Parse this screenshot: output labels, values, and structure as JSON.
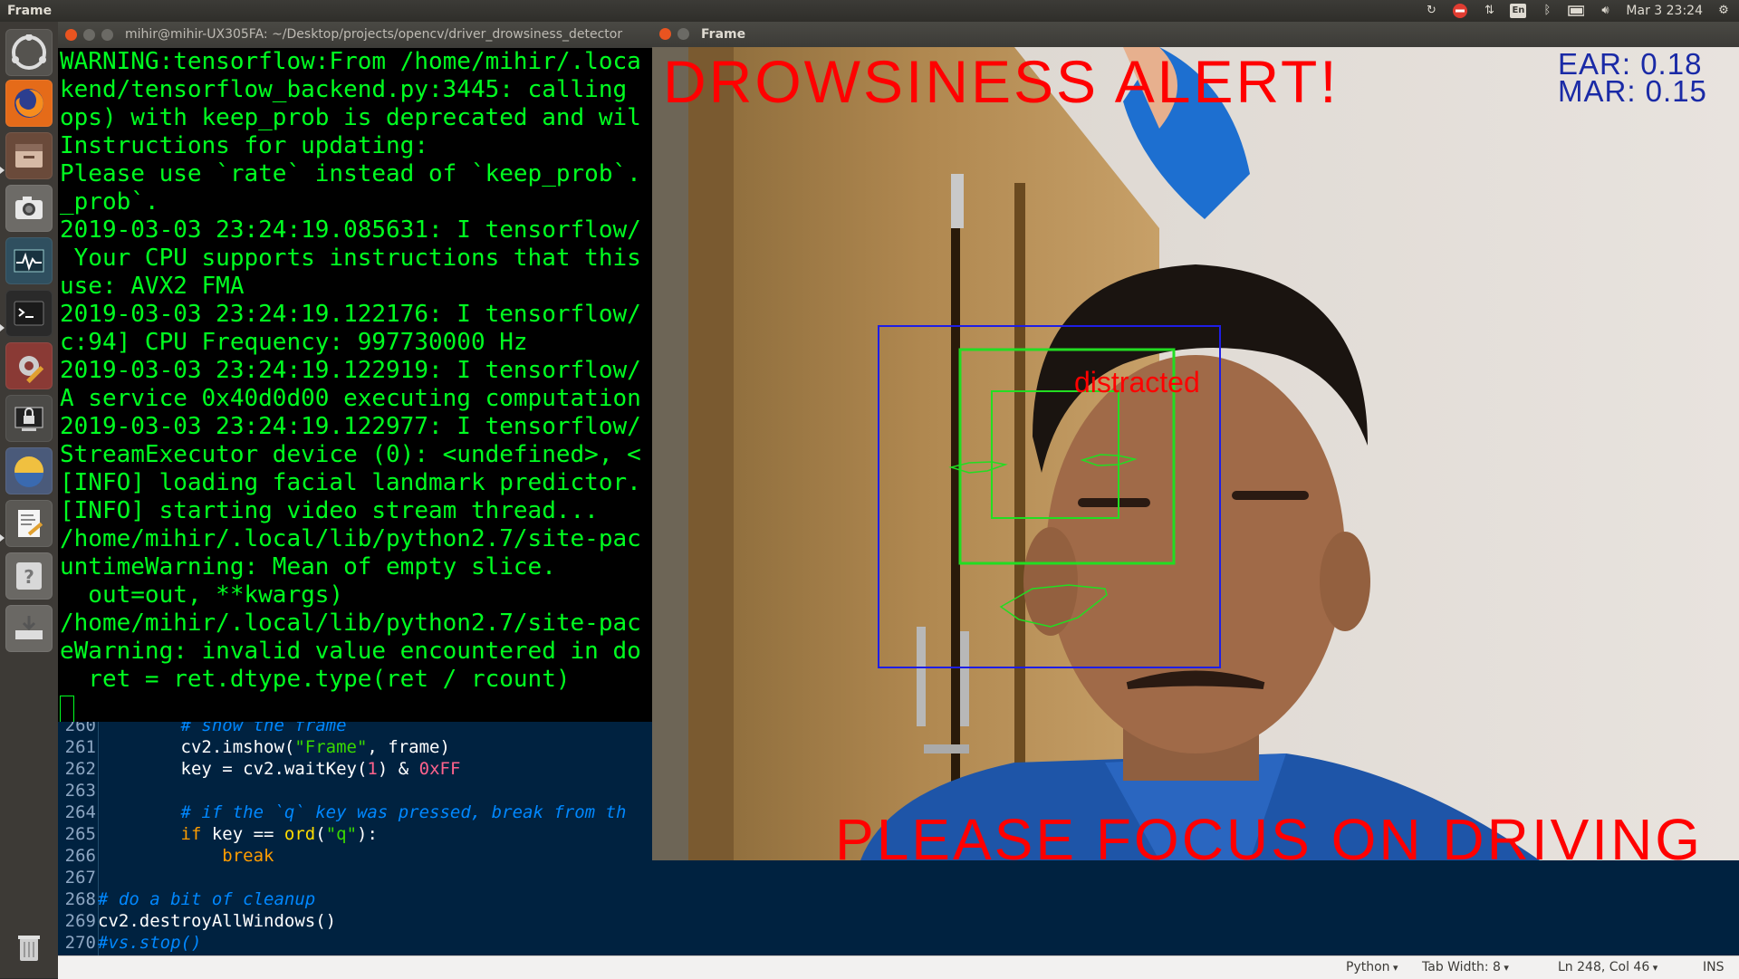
{
  "top_panel": {
    "app_name": "Frame",
    "keyboard_layout": "En",
    "clock": "Mar 3 23:24"
  },
  "launcher": {
    "items": [
      "ubuntu-logo-icon",
      "firefox-icon",
      "files-icon",
      "screenshot-camera-icon",
      "system-monitor-icon",
      "terminal-icon",
      "settings-icon",
      "lock-screen-icon",
      "image-viewer-icon",
      "text-editor-icon",
      "help-icon",
      "disk-install-icon",
      "trash-icon"
    ]
  },
  "terminal_window": {
    "title": "mihir@mihir-UX305FA: ~/Desktop/projects/opencv/driver_drowsiness_detector",
    "lines": [
      "WARNING:tensorflow:From /home/mihir/.loca",
      "kend/tensorflow_backend.py:3445: calling ",
      "ops) with keep_prob is deprecated and wil",
      "Instructions for updating:",
      "Please use `rate` instead of `keep_prob`.",
      "_prob`.",
      "2019-03-03 23:24:19.085631: I tensorflow/",
      " Your CPU supports instructions that this",
      "use: AVX2 FMA",
      "2019-03-03 23:24:19.122176: I tensorflow/",
      "c:94] CPU Frequency: 997730000 Hz",
      "2019-03-03 23:24:19.122919: I tensorflow/",
      "A service 0x40d0d00 executing computation",
      "2019-03-03 23:24:19.122977: I tensorflow/",
      "StreamExecutor device (0): <undefined>, <",
      "[INFO] loading facial landmark predictor.",
      "[INFO] starting video stream thread...",
      "/home/mihir/.local/lib/python2.7/site-pac",
      "untimeWarning: Mean of empty slice.",
      "  out=out, **kwargs)",
      "/home/mihir/.local/lib/python2.7/site-pac",
      "eWarning: invalid value encountered in do",
      "  ret = ret.dtype.type(ret / rcount)"
    ]
  },
  "editor": {
    "lines": [
      {
        "num": "260",
        "segments": [
          {
            "t": "        ",
            "c": ""
          },
          {
            "t": "# show the frame",
            "c": "c-comment"
          }
        ]
      },
      {
        "num": "261",
        "segments": [
          {
            "t": "        cv2.imshow(",
            "c": ""
          },
          {
            "t": "\"Frame\"",
            "c": "c-string"
          },
          {
            "t": ", frame)",
            "c": ""
          }
        ]
      },
      {
        "num": "262",
        "segments": [
          {
            "t": "        key = cv2.waitKey(",
            "c": ""
          },
          {
            "t": "1",
            "c": "c-num"
          },
          {
            "t": ") & ",
            "c": ""
          },
          {
            "t": "0xFF",
            "c": "c-num"
          }
        ]
      },
      {
        "num": "263",
        "segments": []
      },
      {
        "num": "264",
        "segments": [
          {
            "t": "        ",
            "c": ""
          },
          {
            "t": "# if the `q` key was pressed, break from th",
            "c": "c-comment"
          }
        ]
      },
      {
        "num": "265",
        "segments": [
          {
            "t": "        ",
            "c": ""
          },
          {
            "t": "if",
            "c": "c-kw"
          },
          {
            "t": " key == ",
            "c": ""
          },
          {
            "t": "ord",
            "c": "c-bi"
          },
          {
            "t": "(",
            "c": ""
          },
          {
            "t": "\"q\"",
            "c": "c-string"
          },
          {
            "t": "):",
            "c": ""
          }
        ]
      },
      {
        "num": "266",
        "segments": [
          {
            "t": "            ",
            "c": ""
          },
          {
            "t": "break",
            "c": "c-kw"
          }
        ]
      },
      {
        "num": "267",
        "segments": []
      },
      {
        "num": "268",
        "segments": [
          {
            "t": "# do a bit of cleanup",
            "c": "c-comment"
          }
        ]
      },
      {
        "num": "269",
        "segments": [
          {
            "t": "cv2.destroyAllWindows()",
            "c": ""
          }
        ]
      },
      {
        "num": "270",
        "segments": [
          {
            "t": "#vs.stop()",
            "c": "c-comment"
          }
        ]
      }
    ]
  },
  "statusbar": {
    "language": "Python",
    "tab_width": "Tab Width: 8",
    "position": "Ln 248, Col 46",
    "mode": "INS"
  },
  "frame_window": {
    "title": "Frame",
    "alert_top": "DROWSINESS ALERT!",
    "ear_text": "EAR: 0.18",
    "mar_text": "MAR: 0.15",
    "distracted_label": "distracted",
    "alert_bottom": "PLEASE FOCUS ON DRIVING",
    "colors": {
      "alert": "#ff0000",
      "metrics": "#1a2aa6",
      "face_box": "#1e1ee6",
      "landmark_box": "#22dd22"
    }
  }
}
